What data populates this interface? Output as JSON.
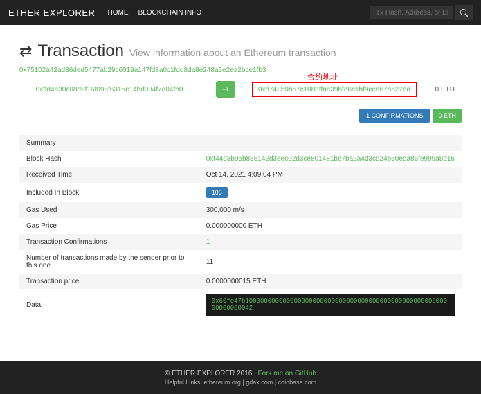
{
  "nav": {
    "brand": "ETHER EXPLORER",
    "home": "HOME",
    "blockchain": "BLOCKCHAIN INFO",
    "search_placeholder": "Tx Hash, Address, or Bl"
  },
  "page": {
    "title": "Transaction",
    "subtitle": "View information about an Ethereum transaction",
    "txhash": "0x75102a42ad36ded5477ab29c6019a147fd8a0c1fdd8da8e248a5e2ea2bce1fb3",
    "from": "0xffd4a30c08d9f16f095f6315e14bd034f7d04fb0",
    "to": "0xd74859b57c108dffae39bfe6c1bf9cea67b527ea",
    "to_label": "合约地址",
    "amount": "0 ETH",
    "conf_btn": "1 CONFIRMATIONS",
    "eth_btn": "0 ETH"
  },
  "summary": {
    "header": "Summary",
    "rows": [
      {
        "k": "Block Hash",
        "v": "0xf44d3b95b836142d3eec02d3ce801481be7ba2a4d3cd24b50eda86fe999a8d16",
        "green": true
      },
      {
        "k": "Received Time",
        "v": "Oct 14, 2021 4:09:04 PM"
      },
      {
        "k": "Included In Block",
        "v": "105",
        "badge": true
      },
      {
        "k": "Gas Used",
        "v": "300,000 m/s"
      },
      {
        "k": "Gas Price",
        "v": "0.000000000 ETH"
      },
      {
        "k": "Transaction Confirmations",
        "v": "1",
        "green": true
      },
      {
        "k": "Number of transactions made by the sender prior to this one",
        "v": "11"
      },
      {
        "k": "Transaction price",
        "v": "0.0000000015 ETH"
      },
      {
        "k": "Data",
        "v": "0x60fe47b10000000000000000000000000000000000000000000000000000000000000042",
        "data": true
      }
    ]
  },
  "footer": {
    "copy": "© ETHER EXPLORER 2016 | ",
    "fork": "Fork me on GitHub",
    "links": "Helpful Links: ethereum.org | gdax.com | coinbase.com"
  }
}
